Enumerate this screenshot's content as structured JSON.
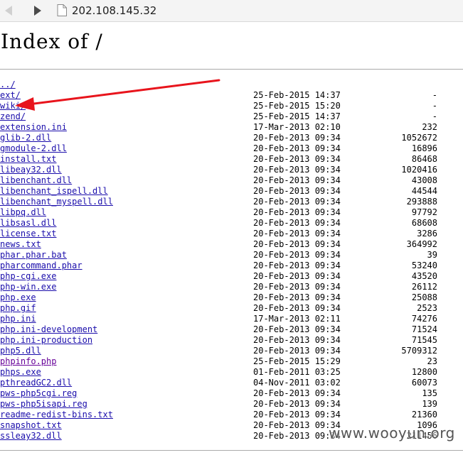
{
  "browser": {
    "address": "202.108.145.32"
  },
  "page": {
    "title": "Index of /",
    "parent_link": "../",
    "entries": [
      {
        "name": "ext/",
        "date": "25-Feb-2015 14:37",
        "size": "-"
      },
      {
        "name": "wiki/",
        "date": "25-Feb-2015 15:20",
        "size": "-"
      },
      {
        "name": "zend/",
        "date": "25-Feb-2015 14:37",
        "size": "-"
      },
      {
        "name": "extension.ini",
        "date": "17-Mar-2013 02:10",
        "size": "232"
      },
      {
        "name": "glib-2.dll",
        "date": "20-Feb-2013 09:34",
        "size": "1052672"
      },
      {
        "name": "gmodule-2.dll",
        "date": "20-Feb-2013 09:34",
        "size": "16896"
      },
      {
        "name": "install.txt",
        "date": "20-Feb-2013 09:34",
        "size": "86468"
      },
      {
        "name": "libeay32.dll",
        "date": "20-Feb-2013 09:34",
        "size": "1020416"
      },
      {
        "name": "libenchant.dll",
        "date": "20-Feb-2013 09:34",
        "size": "43008"
      },
      {
        "name": "libenchant_ispell.dll",
        "date": "20-Feb-2013 09:34",
        "size": "44544"
      },
      {
        "name": "libenchant_myspell.dll",
        "date": "20-Feb-2013 09:34",
        "size": "293888"
      },
      {
        "name": "libpq.dll",
        "date": "20-Feb-2013 09:34",
        "size": "97792"
      },
      {
        "name": "libsasl.dll",
        "date": "20-Feb-2013 09:34",
        "size": "68608"
      },
      {
        "name": "license.txt",
        "date": "20-Feb-2013 09:34",
        "size": "3286"
      },
      {
        "name": "news.txt",
        "date": "20-Feb-2013 09:34",
        "size": "364992"
      },
      {
        "name": "phar.phar.bat",
        "date": "20-Feb-2013 09:34",
        "size": "39"
      },
      {
        "name": "pharcommand.phar",
        "date": "20-Feb-2013 09:34",
        "size": "53240"
      },
      {
        "name": "php-cgi.exe",
        "date": "20-Feb-2013 09:34",
        "size": "43520"
      },
      {
        "name": "php-win.exe",
        "date": "20-Feb-2013 09:34",
        "size": "26112"
      },
      {
        "name": "php.exe",
        "date": "20-Feb-2013 09:34",
        "size": "25088"
      },
      {
        "name": "php.gif",
        "date": "20-Feb-2013 09:34",
        "size": "2523"
      },
      {
        "name": "php.ini",
        "date": "17-Mar-2013 02:11",
        "size": "74276"
      },
      {
        "name": "php.ini-development",
        "date": "20-Feb-2013 09:34",
        "size": "71524"
      },
      {
        "name": "php.ini-production",
        "date": "20-Feb-2013 09:34",
        "size": "71545"
      },
      {
        "name": "php5.dll",
        "date": "20-Feb-2013 09:34",
        "size": "5709312"
      },
      {
        "name": "phpinfo.php",
        "date": "25-Feb-2015 15:29",
        "size": "23",
        "visited": true
      },
      {
        "name": "phps.exe",
        "date": "01-Feb-2011 03:25",
        "size": "12800"
      },
      {
        "name": "pthreadGC2.dll",
        "date": "04-Nov-2011 03:02",
        "size": "60073"
      },
      {
        "name": "pws-php5cgi.reg",
        "date": "20-Feb-2013 09:34",
        "size": "135"
      },
      {
        "name": "pws-php5isapi.reg",
        "date": "20-Feb-2013 09:34",
        "size": "139"
      },
      {
        "name": "readme-redist-bins.txt",
        "date": "20-Feb-2013 09:34",
        "size": "21360"
      },
      {
        "name": "snapshot.txt",
        "date": "20-Feb-2013 09:34",
        "size": "1096"
      },
      {
        "name": "ssleay32.dll",
        "date": "20-Feb-2013 09:34",
        "size": "211456"
      }
    ]
  },
  "watermark": "www.wooyun.org",
  "colors": {
    "link": "#1a0dab",
    "visited_link": "#660099",
    "annotation_arrow": "#e8141c"
  },
  "icons": {
    "back": "back-arrow-icon",
    "forward": "forward-arrow-icon",
    "page": "page-icon"
  }
}
